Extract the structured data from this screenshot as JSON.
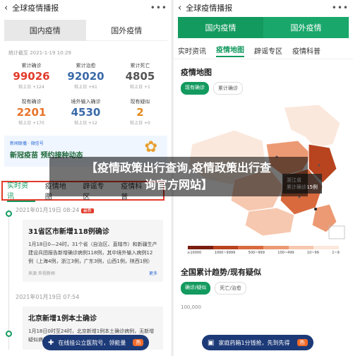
{
  "left": {
    "topbar": {
      "title": "全球疫情播报"
    },
    "segments": [
      "国内疫情",
      "国外疫情"
    ],
    "stamp": "统计截至 2021-1-19 10:29",
    "stats": [
      {
        "label": "累计确诊",
        "value": "99026",
        "delta": "较上日 +124"
      },
      {
        "label": "累计治愈",
        "value": "92020",
        "delta": "较上日 +61"
      },
      {
        "label": "累计死亡",
        "value": "4805",
        "delta": "较上日 +1"
      },
      {
        "label": "现有确诊",
        "value": "2201",
        "delta": "较上日 +170"
      },
      {
        "label": "境外输入确诊",
        "value": "4530",
        "delta": "较上日 +12"
      },
      {
        "label": "现有疑似",
        "value": "2",
        "delta": "较上日 +0"
      }
    ],
    "banner": {
      "tag": "新闻联播 · 微信号",
      "title": "新冠疫苗 预约接种动态"
    },
    "tabs": [
      "实时资讯",
      "疫情地图",
      "辟谣专区",
      "疫情科普"
    ],
    "feed": [
      {
        "date": "2021年01月19日 08:24",
        "tag": "最新",
        "title": "31省区市新增118例确诊",
        "body": "1月18日0—24时，31个省（自治区、直辖市）和新疆生产建设兵团报告新增确诊病例118例，其中境外输入病例12例（上海4例，浙江3例，广东3例，山西1例，陕西1例）",
        "source": "来源 央视新闻",
        "more": "更多"
      },
      {
        "date": "2021年01月19日 07:54",
        "title": "北京新增1例本土确诊",
        "body": "1月18日0时至24时，北京新增1例本土确诊病例，无新增疑似病例"
      }
    ],
    "pill": {
      "text": "在线挂公立医院号，领能量",
      "badge": "热"
    }
  },
  "right": {
    "topbar": {
      "title": "全球疫情播报"
    },
    "segments": [
      "国内疫情",
      "国外疫情"
    ],
    "tabs": [
      "实时资讯",
      "疫情地图",
      "辟谣专区",
      "疫情科普"
    ],
    "map": {
      "title": "疫情地图",
      "pills": [
        "现有确诊",
        "累计确诊"
      ],
      "tooltip": {
        "province": "浙江省",
        "value": "累计确诊15例"
      },
      "legend": [
        "≥10000",
        "1000~9999",
        "500~999",
        "100~499",
        "10~99",
        "1~9"
      ],
      "legend_colors": [
        "#7a1f10",
        "#b8431f",
        "#d86a3e",
        "#ec9a73",
        "#f6c8b0",
        "#fbe8dc"
      ]
    },
    "trend": {
      "title": "全国累计趋势/现有疑似",
      "pills": [
        "确诊/疑似",
        "死亡/治愈"
      ],
      "axis_label": "100,000"
    },
    "pill": {
      "text": "家庭药箱1分钱抢，先到先得",
      "badge": "热"
    }
  },
  "overlay": {
    "line1": "【疫情政策出行查询,疫情政策出行查",
    "line2": "询官方网站】"
  }
}
